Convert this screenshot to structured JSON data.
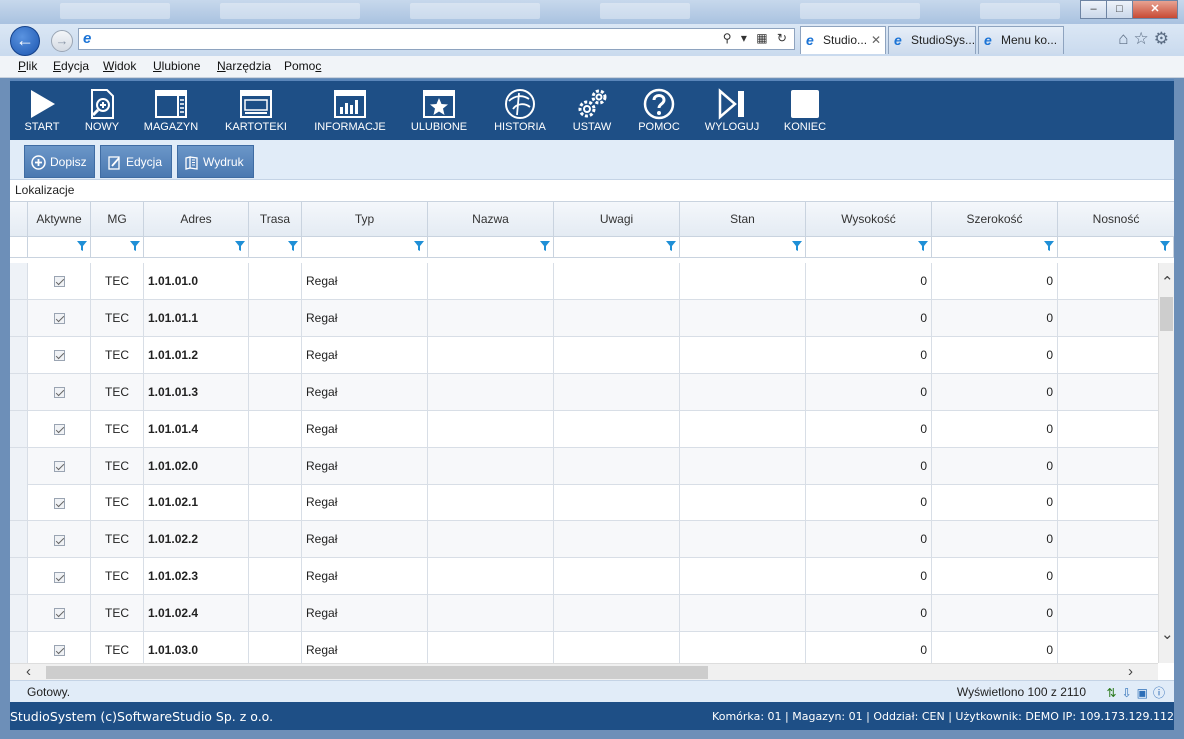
{
  "browser": {
    "address_value": "",
    "tabs": [
      {
        "label": "Studio..."
      },
      {
        "label": "StudioSys..."
      },
      {
        "label": "Menu ko..."
      }
    ],
    "window_buttons": {
      "minimize": "–",
      "maximize": "□",
      "close": "✕"
    }
  },
  "menubar": {
    "items": [
      {
        "label": "Plik",
        "u": "P",
        "rest": "lik"
      },
      {
        "label": "Edycja",
        "u": "E",
        "rest": "dycja"
      },
      {
        "label": "Widok",
        "u": "W",
        "rest": "idok"
      },
      {
        "label": "Ulubione",
        "u": "U",
        "rest": "lubione"
      },
      {
        "label": "Narzędzia",
        "u": "N",
        "rest": "arzędzia"
      },
      {
        "label": "Pomoc",
        "pre": "Pomo",
        "u": "c"
      }
    ]
  },
  "toolbar": {
    "items": [
      {
        "label": "START",
        "icon": "play-icon"
      },
      {
        "label": "NOWY",
        "icon": "new-document-icon"
      },
      {
        "label": "MAGAZYN",
        "icon": "warehouse-icon"
      },
      {
        "label": "KARTOTEKI",
        "icon": "records-icon"
      },
      {
        "label": "INFORMACJE",
        "icon": "bar-chart-icon"
      },
      {
        "label": "ULUBIONE",
        "icon": "star-icon"
      },
      {
        "label": "HISTORIA",
        "icon": "history-icon"
      },
      {
        "label": "USTAW",
        "icon": "gears-icon"
      },
      {
        "label": "POMOC",
        "icon": "question-icon"
      },
      {
        "label": "WYLOGUJ",
        "icon": "logout-icon"
      },
      {
        "label": "KONIEC",
        "icon": "stop-icon"
      }
    ]
  },
  "actions": {
    "add": "Dopisz",
    "edit": "Edycja",
    "print": "Wydruk"
  },
  "section_title": "Lokalizacje",
  "grid": {
    "columns": [
      "Aktywne",
      "MG",
      "Adres",
      "Trasa",
      "Typ",
      "Nazwa",
      "Uwagi",
      "Stan",
      "Wysokość",
      "Szerokość",
      "Nosność"
    ],
    "rows": [
      {
        "aktywne": true,
        "mg": "TEC",
        "adres": "1.01.01.0",
        "trasa": "",
        "typ": "Regał",
        "nazwa": "",
        "uwagi": "",
        "stan": "",
        "wysokosc": "0",
        "szerokosc": "0",
        "nosnosc": ""
      },
      {
        "aktywne": true,
        "mg": "TEC",
        "adres": "1.01.01.1",
        "trasa": "",
        "typ": "Regał",
        "nazwa": "",
        "uwagi": "",
        "stan": "",
        "wysokosc": "0",
        "szerokosc": "0",
        "nosnosc": ""
      },
      {
        "aktywne": true,
        "mg": "TEC",
        "adres": "1.01.01.2",
        "trasa": "",
        "typ": "Regał",
        "nazwa": "",
        "uwagi": "",
        "stan": "",
        "wysokosc": "0",
        "szerokosc": "0",
        "nosnosc": ""
      },
      {
        "aktywne": true,
        "mg": "TEC",
        "adres": "1.01.01.3",
        "trasa": "",
        "typ": "Regał",
        "nazwa": "",
        "uwagi": "",
        "stan": "",
        "wysokosc": "0",
        "szerokosc": "0",
        "nosnosc": ""
      },
      {
        "aktywne": true,
        "mg": "TEC",
        "adres": "1.01.01.4",
        "trasa": "",
        "typ": "Regał",
        "nazwa": "",
        "uwagi": "",
        "stan": "",
        "wysokosc": "0",
        "szerokosc": "0",
        "nosnosc": ""
      },
      {
        "aktywne": true,
        "mg": "TEC",
        "adres": "1.01.02.0",
        "trasa": "",
        "typ": "Regał",
        "nazwa": "",
        "uwagi": "",
        "stan": "",
        "wysokosc": "0",
        "szerokosc": "0",
        "nosnosc": ""
      },
      {
        "aktywne": true,
        "mg": "TEC",
        "adres": "1.01.02.1",
        "trasa": "",
        "typ": "Regał",
        "nazwa": "",
        "uwagi": "",
        "stan": "",
        "wysokosc": "0",
        "szerokosc": "0",
        "nosnosc": ""
      },
      {
        "aktywne": true,
        "mg": "TEC",
        "adres": "1.01.02.2",
        "trasa": "",
        "typ": "Regał",
        "nazwa": "",
        "uwagi": "",
        "stan": "",
        "wysokosc": "0",
        "szerokosc": "0",
        "nosnosc": ""
      },
      {
        "aktywne": true,
        "mg": "TEC",
        "adres": "1.01.02.3",
        "trasa": "",
        "typ": "Regał",
        "nazwa": "",
        "uwagi": "",
        "stan": "",
        "wysokosc": "0",
        "szerokosc": "0",
        "nosnosc": ""
      },
      {
        "aktywne": true,
        "mg": "TEC",
        "adres": "1.01.02.4",
        "trasa": "",
        "typ": "Regał",
        "nazwa": "",
        "uwagi": "",
        "stan": "",
        "wysokosc": "0",
        "szerokosc": "0",
        "nosnosc": ""
      },
      {
        "aktywne": true,
        "mg": "TEC",
        "adres": "1.01.03.0",
        "trasa": "",
        "typ": "Regał",
        "nazwa": "",
        "uwagi": "",
        "stan": "",
        "wysokosc": "0",
        "szerokosc": "0",
        "nosnosc": ""
      }
    ]
  },
  "status": {
    "left": "Gotowy.",
    "right": "Wyświetlono 100 z 2110"
  },
  "footer": {
    "left": "StudioSystem (c)SoftwareStudio Sp. z o.o.",
    "right": "Komórka: 01 | Magazyn: 01 | Oddział: CEN | Użytkownik: DEMO IP: 109.173.129.112"
  },
  "colors": {
    "toolbar_bg": "#1e4f86",
    "button_bg": "#5a86bd",
    "subbar_bg": "#e1ecf8"
  }
}
